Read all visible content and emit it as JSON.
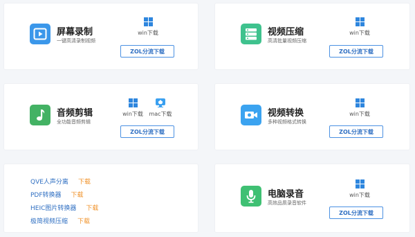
{
  "cards": [
    {
      "name": "屏幕录制",
      "desc": "一键高清录制视频",
      "icon": "screen-record-icon",
      "icon_color": "#3b97ea",
      "downloads": [
        {
          "os": "windows-icon",
          "label": "win下载"
        }
      ],
      "button": "ZOL分流下载"
    },
    {
      "name": "视频压缩",
      "desc": "高清批量视频压缩",
      "icon": "compress-icon",
      "icon_color": "#3fc28e",
      "downloads": [
        {
          "os": "windows-icon",
          "label": "win下载"
        }
      ],
      "button": "ZOL分流下载"
    },
    {
      "name": "音频剪辑",
      "desc": "全功能音频剪辑",
      "icon": "music-note-icon",
      "icon_color": "#43b264",
      "downloads": [
        {
          "os": "windows-icon",
          "label": "win下载"
        },
        {
          "os": "mac-icon",
          "label": "mac下载"
        }
      ],
      "button": "ZOL分流下载"
    },
    {
      "name": "视频转换",
      "desc": "多种视频格式转换",
      "icon": "video-camera-icon",
      "icon_color": "#3ba3f0",
      "downloads": [
        {
          "os": "windows-icon",
          "label": "win下载"
        }
      ],
      "button": "ZOL分流下载"
    },
    {
      "name": "电脑录音",
      "desc": "高效品质录音软件",
      "icon": "microphone-icon",
      "icon_color": "#3fc073",
      "downloads": [
        {
          "os": "windows-icon",
          "label": "win下载"
        }
      ],
      "button": "ZOL分流下载"
    }
  ],
  "links": [
    {
      "name": "QVE人声分离",
      "download": "下载"
    },
    {
      "name": "PDF转换器",
      "download": "下载"
    },
    {
      "name": "HEIC图片转换器",
      "download": "下载"
    },
    {
      "name": "极简视频压缩",
      "download": "下载"
    }
  ],
  "colors": {
    "accent": "#2f6fc2",
    "link_download": "#f0932b",
    "windows_blue": "#2e86de",
    "mac_blue": "#3aa0f0"
  }
}
